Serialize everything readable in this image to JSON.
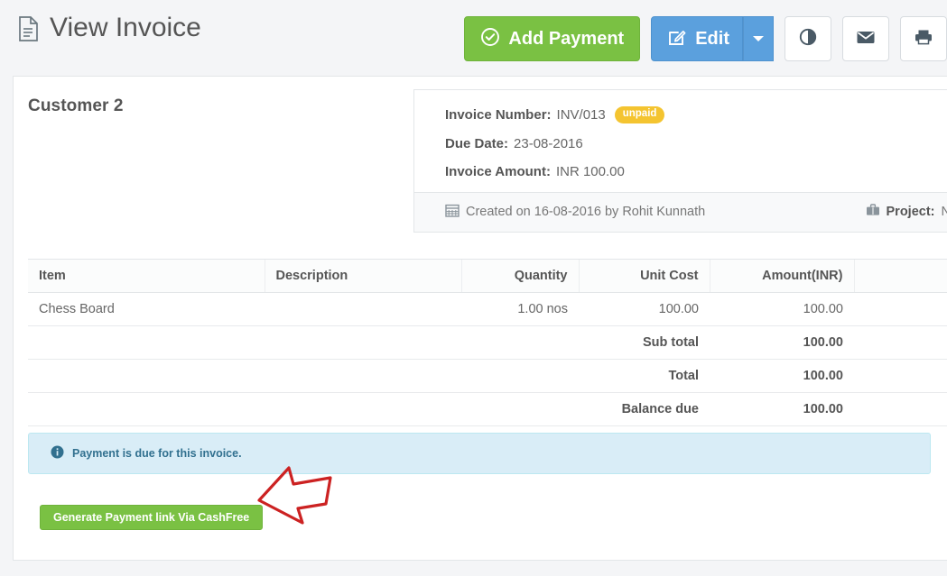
{
  "header": {
    "title": "View Invoice",
    "doc_icon": "document-icon",
    "actions": {
      "add_payment": {
        "label": "Add Payment",
        "icon": "check-circle-icon",
        "color": "#7ac143"
      },
      "edit": {
        "label": "Edit",
        "icon": "pencil-square-icon",
        "color": "#5ba0dd",
        "caret": "chevron-down-icon"
      },
      "contrast": {
        "icon": "contrast-icon"
      },
      "email": {
        "icon": "envelope-icon"
      },
      "print": {
        "icon": "printer-icon"
      }
    }
  },
  "invoice": {
    "customer_name": "Customer 2",
    "number_label": "Invoice Number:",
    "number_value": "INV/013",
    "status_badge": "unpaid",
    "status_color": "#f4c430",
    "due_date_label": "Due Date:",
    "due_date_value": "23-08-2016",
    "amount_label": "Invoice Amount:",
    "amount_value": "INR 100.00",
    "created_icon": "calendar-icon",
    "created_text": "Created on 16-08-2016 by Rohit Kunnath",
    "project_icon": "briefcase-icon",
    "project_label": "Project:",
    "project_value": "N"
  },
  "items_table": {
    "columns": [
      "Item",
      "Description",
      "Quantity",
      "Unit Cost",
      "Amount(INR)",
      ""
    ],
    "rows": [
      {
        "item": "Chess Board",
        "description": "",
        "quantity": "1.00 nos",
        "unit_cost": "100.00",
        "amount": "100.00",
        "tail": ""
      }
    ],
    "totals": [
      {
        "label": "Sub total",
        "value": "100.00"
      },
      {
        "label": "Total",
        "value": "100.00"
      },
      {
        "label": "Balance due",
        "value": "100.00"
      }
    ]
  },
  "alert": {
    "icon": "info-circle-icon",
    "text": "Payment is due for this invoice.",
    "bg_color": "#d9edf7",
    "text_color": "#31708f"
  },
  "cashfree_button": {
    "label": "Generate Payment link Via CashFree",
    "color": "#7ac143"
  },
  "annotation": {
    "shape": "arrow-pointing-left",
    "color": "#cc2222"
  }
}
